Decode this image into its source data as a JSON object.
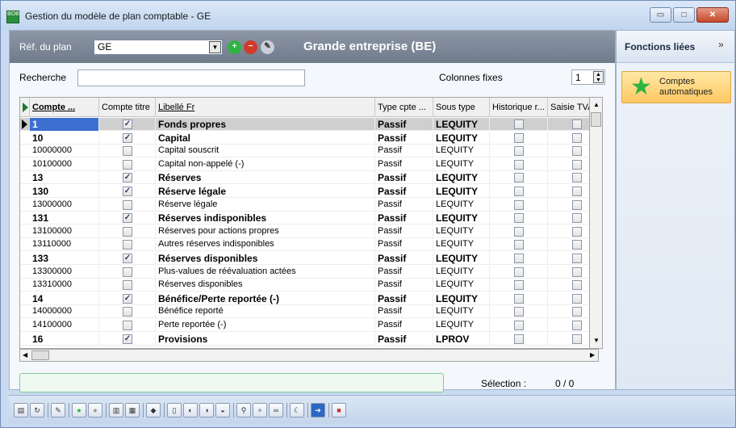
{
  "window": {
    "title": "Gestion du modèle de plan comptable - GE",
    "icon_text": "BOB",
    "buttons": [
      "minimize-icon",
      "maximize-icon",
      "close-icon"
    ],
    "btn_min": "▭",
    "btn_max": "□",
    "btn_close": "✕"
  },
  "topbar": {
    "ref_label": "Réf. du plan",
    "ref_value": "GE",
    "plan_name": "Grande entreprise (BE)",
    "btn_add": "+",
    "btn_remove": "−",
    "btn_pen": "✎"
  },
  "search": {
    "label": "Recherche",
    "value": "",
    "fixed_cols_label": "Colonnes fixes",
    "fixed_cols_value": "1"
  },
  "grid": {
    "columns": [
      "Compte ...",
      "Compte titre",
      "Libellé Fr",
      "Type cpte ...",
      "Sous type",
      "Historique r...",
      "Saisie TVA...",
      ":"
    ],
    "rows": [
      {
        "compte": "1",
        "titre": true,
        "libelle": "Fonds propres",
        "type": "Passif",
        "sous": "LEQUITY",
        "bold": true,
        "selected": true
      },
      {
        "compte": "10",
        "titre": true,
        "libelle": "Capital",
        "type": "Passif",
        "sous": "LEQUITY",
        "bold": true
      },
      {
        "compte": "10000000",
        "titre": false,
        "libelle": "Capital souscrit",
        "type": "Passif",
        "sous": "LEQUITY",
        "bold": false
      },
      {
        "compte": "10100000",
        "titre": false,
        "libelle": "Capital non-appelé (-)",
        "type": "Passif",
        "sous": "LEQUITY",
        "bold": false
      },
      {
        "compte": "13",
        "titre": true,
        "libelle": "Réserves",
        "type": "Passif",
        "sous": "LEQUITY",
        "bold": true
      },
      {
        "compte": "130",
        "titre": true,
        "libelle": "Réserve légale",
        "type": "Passif",
        "sous": "LEQUITY",
        "bold": true
      },
      {
        "compte": "13000000",
        "titre": false,
        "libelle": "Réserve légale",
        "type": "Passif",
        "sous": "LEQUITY",
        "bold": false
      },
      {
        "compte": "131",
        "titre": true,
        "libelle": "Réserves indisponibles",
        "type": "Passif",
        "sous": "LEQUITY",
        "bold": true
      },
      {
        "compte": "13100000",
        "titre": false,
        "libelle": "Réserves pour actions propres",
        "type": "Passif",
        "sous": "LEQUITY",
        "bold": false
      },
      {
        "compte": "13110000",
        "titre": false,
        "libelle": "Autres réserves indisponibles",
        "type": "Passif",
        "sous": "LEQUITY",
        "bold": false
      },
      {
        "compte": "133",
        "titre": true,
        "libelle": "Réserves disponibles",
        "type": "Passif",
        "sous": "LEQUITY",
        "bold": true
      },
      {
        "compte": "13300000",
        "titre": false,
        "libelle": "Plus-values de réévaluation actées",
        "type": "Passif",
        "sous": "LEQUITY",
        "bold": false
      },
      {
        "compte": "13310000",
        "titre": false,
        "libelle": "Réserves disponibles",
        "type": "Passif",
        "sous": "LEQUITY",
        "bold": false
      },
      {
        "compte": "14",
        "titre": true,
        "libelle": "Bénéfice/Perte reportée (-)",
        "type": "Passif",
        "sous": "LEQUITY",
        "bold": true
      },
      {
        "compte": "14000000",
        "titre": false,
        "libelle": "Bénéfice reporté",
        "type": "Passif",
        "sous": "LEQUITY",
        "bold": false
      },
      {
        "compte": "14100000",
        "titre": false,
        "libelle": "Perte reportée (-)",
        "type": "Passif",
        "sous": "LEQUITY",
        "bold": false
      },
      {
        "compte": "16",
        "titre": true,
        "libelle": "Provisions",
        "type": "Passif",
        "sous": "LPROV",
        "bold": true
      }
    ]
  },
  "status": {
    "selection_label": "Sélection :",
    "selection_value": "0 / 0"
  },
  "right_panel": {
    "title": "Fonctions liées",
    "item_label_1": "Comptes",
    "item_label_2": "automatiques",
    "chevron": "»"
  },
  "colors": {
    "topbar": "#7a8494",
    "accent_green": "#2fb342",
    "accent_red": "#d23a2a",
    "item_bg": "#ffd27a"
  }
}
